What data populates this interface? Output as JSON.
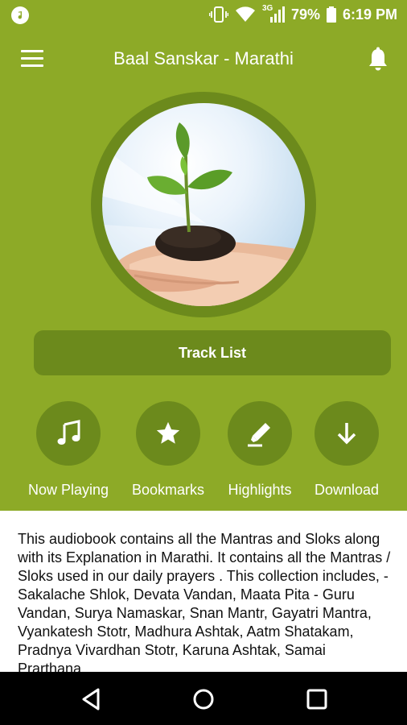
{
  "status_bar": {
    "battery_percent": "79%",
    "time": "6:19 PM",
    "network": "3G",
    "icons": [
      "music-app-icon",
      "vibrate-icon",
      "wifi-icon",
      "signal-icon",
      "battery-icon"
    ]
  },
  "app_bar": {
    "title": "Baal Sanskar - Marathi",
    "icons": [
      "menu-icon",
      "bell-icon"
    ]
  },
  "track_list": {
    "label": "Track List"
  },
  "actions": [
    {
      "label": "Now Playing",
      "icon": "music-note-icon"
    },
    {
      "label": "Bookmarks",
      "icon": "star-icon"
    },
    {
      "label": "Highlights",
      "icon": "highlighter-icon"
    },
    {
      "label": "Download",
      "icon": "download-icon"
    }
  ],
  "description": "This audiobook contains all the Mantras and Sloks along with its Explanation in Marathi. It contains all the Mantras / Sloks used in our daily prayers . This collection includes, - Sakalache Shlok, Devata Vandan, Maata Pita - Guru Vandan, Surya Namaskar, Snan Mantr, Gayatri Mantra, Vyankatesh Stotr, Madhura Ashtak, Aatm Shatakam, Pradnya Vivardhan Stotr, Karuna Ashtak, Samai Prarthana",
  "colors": {
    "primary": "#8daa27",
    "primary_dark": "#6c8a1c",
    "text_light": "#ffffff",
    "body_text": "#111111"
  }
}
